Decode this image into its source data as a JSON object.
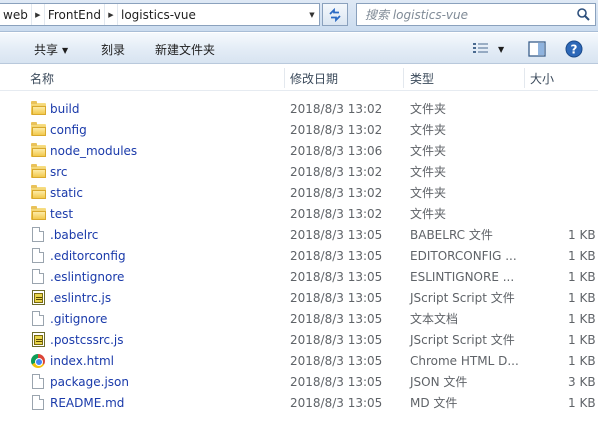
{
  "address": {
    "crumbs": [
      "web",
      "FrontEnd",
      "logistics-vue"
    ],
    "search_placeholder": "搜索 logistics-vue"
  },
  "toolbar": {
    "share_label": "共享",
    "burn_label": "刻录",
    "new_folder_label": "新建文件夹"
  },
  "columns": {
    "name": "名称",
    "date": "修改日期",
    "type": "类型",
    "size": "大小"
  },
  "files": [
    {
      "name": "build",
      "date": "2018/8/3 13:02",
      "type": "文件夹",
      "size": "",
      "icon": "folder-icon"
    },
    {
      "name": "config",
      "date": "2018/8/3 13:02",
      "type": "文件夹",
      "size": "",
      "icon": "folder-icon"
    },
    {
      "name": "node_modules",
      "date": "2018/8/3 13:06",
      "type": "文件夹",
      "size": "",
      "icon": "folder-icon"
    },
    {
      "name": "src",
      "date": "2018/8/3 13:02",
      "type": "文件夹",
      "size": "",
      "icon": "folder-icon"
    },
    {
      "name": "static",
      "date": "2018/8/3 13:02",
      "type": "文件夹",
      "size": "",
      "icon": "folder-icon"
    },
    {
      "name": "test",
      "date": "2018/8/3 13:02",
      "type": "文件夹",
      "size": "",
      "icon": "folder-icon"
    },
    {
      "name": ".babelrc",
      "date": "2018/8/3 13:05",
      "type": "BABELRC 文件",
      "size": "1 KB",
      "icon": "file-icon"
    },
    {
      "name": ".editorconfig",
      "date": "2018/8/3 13:05",
      "type": "EDITORCONFIG ...",
      "size": "1 KB",
      "icon": "file-icon"
    },
    {
      "name": ".eslintignore",
      "date": "2018/8/3 13:05",
      "type": "ESLINTIGNORE ...",
      "size": "1 KB",
      "icon": "file-icon"
    },
    {
      "name": ".eslintrc.js",
      "date": "2018/8/3 13:05",
      "type": "JScript Script 文件",
      "size": "1 KB",
      "icon": "jscript-icon"
    },
    {
      "name": ".gitignore",
      "date": "2018/8/3 13:05",
      "type": "文本文档",
      "size": "1 KB",
      "icon": "file-icon"
    },
    {
      "name": ".postcssrc.js",
      "date": "2018/8/3 13:05",
      "type": "JScript Script 文件",
      "size": "1 KB",
      "icon": "jscript-icon"
    },
    {
      "name": "index.html",
      "date": "2018/8/3 13:05",
      "type": "Chrome HTML D...",
      "size": "1 KB",
      "icon": "chrome-icon"
    },
    {
      "name": "package.json",
      "date": "2018/8/3 13:05",
      "type": "JSON 文件",
      "size": "3 KB",
      "icon": "file-icon"
    },
    {
      "name": "README.md",
      "date": "2018/8/3 13:05",
      "type": "MD 文件",
      "size": "1 KB",
      "icon": "file-icon"
    }
  ]
}
